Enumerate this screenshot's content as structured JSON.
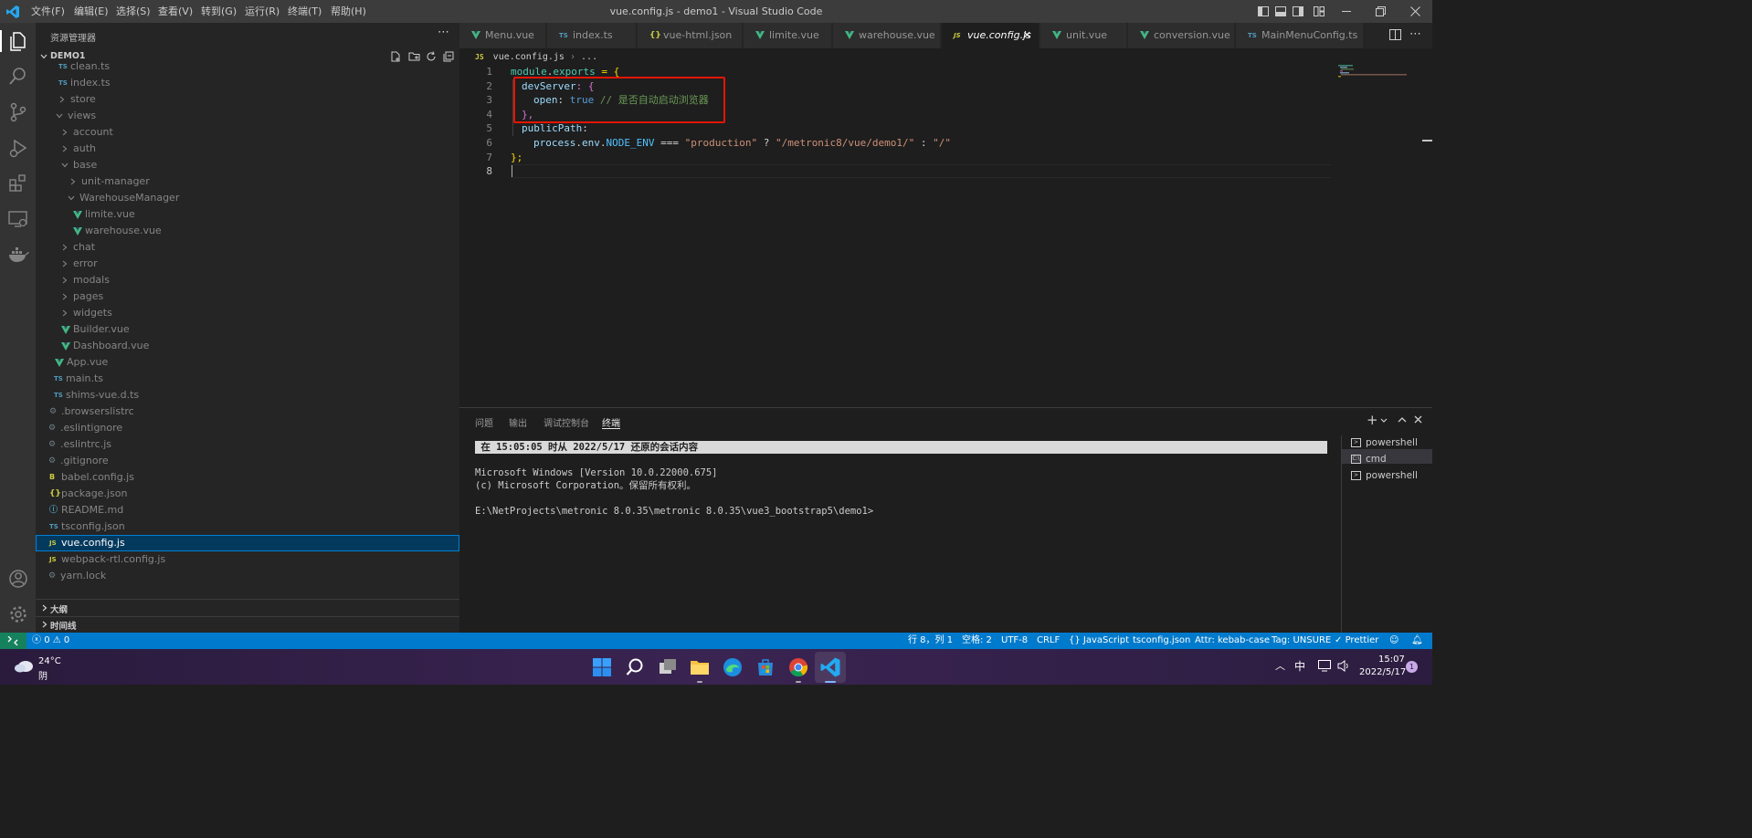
{
  "window": {
    "title": "vue.config.js - demo1 - Visual Studio Code",
    "menu": [
      "文件(F)",
      "编辑(E)",
      "选择(S)",
      "查看(V)",
      "转到(G)",
      "运行(R)",
      "终端(T)",
      "帮助(H)"
    ]
  },
  "sidebar": {
    "header": "资源管理器",
    "folder": "DEMO1",
    "items": [
      {
        "label": "clean.ts",
        "kind": "ts"
      },
      {
        "label": "index.ts",
        "kind": "ts"
      },
      {
        "label": "store",
        "kind": "folder-closed"
      },
      {
        "label": "views",
        "kind": "folder-open"
      },
      {
        "label": "account",
        "kind": "folder-closed"
      },
      {
        "label": "auth",
        "kind": "folder-closed"
      },
      {
        "label": "base",
        "kind": "folder-open"
      },
      {
        "label": "unit-manager",
        "kind": "folder-closed"
      },
      {
        "label": "WarehouseManager",
        "kind": "folder-open"
      },
      {
        "label": "limite.vue",
        "kind": "vue"
      },
      {
        "label": "warehouse.vue",
        "kind": "vue"
      },
      {
        "label": "chat",
        "kind": "folder-closed"
      },
      {
        "label": "error",
        "kind": "folder-closed"
      },
      {
        "label": "modals",
        "kind": "folder-closed"
      },
      {
        "label": "pages",
        "kind": "folder-closed"
      },
      {
        "label": "widgets",
        "kind": "folder-closed"
      },
      {
        "label": "Builder.vue",
        "kind": "vue"
      },
      {
        "label": "Dashboard.vue",
        "kind": "vue"
      },
      {
        "label": "App.vue",
        "kind": "vue"
      },
      {
        "label": "main.ts",
        "kind": "ts"
      },
      {
        "label": "shims-vue.d.ts",
        "kind": "ts"
      },
      {
        "label": ".browserslistrc",
        "kind": "config"
      },
      {
        "label": ".eslintignore",
        "kind": "config"
      },
      {
        "label": ".eslintrc.js",
        "kind": "config"
      },
      {
        "label": ".gitignore",
        "kind": "config"
      },
      {
        "label": "babel.config.js",
        "kind": "babel"
      },
      {
        "label": "package.json",
        "kind": "json"
      },
      {
        "label": "README.md",
        "kind": "info"
      },
      {
        "label": "tsconfig.json",
        "kind": "tsconfig"
      },
      {
        "label": "vue.config.js",
        "kind": "js"
      },
      {
        "label": "webpack-rtl.config.js",
        "kind": "js"
      },
      {
        "label": "yarn.lock",
        "kind": "config"
      }
    ],
    "outline": "大纲",
    "timeline": "时间线"
  },
  "tabs": [
    {
      "label": "Menu.vue",
      "kind": "vue"
    },
    {
      "label": "index.ts",
      "kind": "ts"
    },
    {
      "label": "vue-html.json",
      "kind": "json"
    },
    {
      "label": "limite.vue",
      "kind": "vue"
    },
    {
      "label": "warehouse.vue",
      "kind": "vue"
    },
    {
      "label": "vue.config.js",
      "kind": "js"
    },
    {
      "label": "unit.vue",
      "kind": "vue"
    },
    {
      "label": "conversion.vue",
      "kind": "vue"
    },
    {
      "label": "MainMenuConfig.ts",
      "kind": "ts"
    }
  ],
  "breadcrumb": {
    "file": "vue.config.js",
    "rest": "..."
  },
  "code": {
    "line_numbers": [
      "1",
      "2",
      "3",
      "4",
      "5",
      "6",
      "7",
      "8"
    ],
    "l1": {
      "a": "module",
      "b": ".",
      "c": "exports",
      "d": " = {"
    },
    "l2": {
      "a": "devServer",
      "b": ": {"
    },
    "l3": {
      "a": "open",
      "b": ": ",
      "c": "true",
      "d": " // 是否自动启动浏览器"
    },
    "l4": {
      "a": "},"
    },
    "l5": {
      "a": "publicPath",
      "b": ":"
    },
    "l6": {
      "a": "process",
      "b": ".",
      "c": "env",
      "d": ".",
      "e": "NODE_ENV",
      "f": " === ",
      "g": "\"production\"",
      "h": " ? ",
      "i": "\"/metronic8/vue/demo1/\"",
      "j": " : ",
      "k": "\"/\""
    },
    "l7": {
      "a": "};"
    }
  },
  "panel": {
    "tabs": [
      "问题",
      "输出",
      "调试控制台",
      "终端"
    ],
    "terminal": {
      "restored": " 在 15:05:05 时从 2022/5/17 还原的会话内容",
      "line1": "Microsoft Windows [Version 10.0.22000.675]",
      "line2": "(c) Microsoft Corporation。保留所有权利。",
      "prompt": "E:\\NetProjects\\metronic 8.0.35\\metronic 8.0.35\\vue3_bootstrap5\\demo1>"
    },
    "shells": [
      "powershell",
      "cmd",
      "powershell"
    ]
  },
  "statusbar": {
    "errors": "0",
    "warnings": "0",
    "position": "行 8，列 1",
    "spaces": "空格: 2",
    "encoding": "UTF-8",
    "eol": "CRLF",
    "language": "JavaScript",
    "tsconfig": "tsconfig.json",
    "attr": "Attr: kebab-case",
    "tag": "Tag: UNSURE",
    "prettier": "Prettier"
  },
  "taskbar": {
    "temperature": "24°C",
    "weather": "阴",
    "ime": "中",
    "time": "15:07",
    "date": "2022/5/17",
    "notifications": "1"
  },
  "colors": {
    "accent": "#007acc",
    "highlight_box": "#e51400",
    "vue_green": "#41b883",
    "ts_blue": "#519aba",
    "js_yellow": "#cbcb41"
  }
}
